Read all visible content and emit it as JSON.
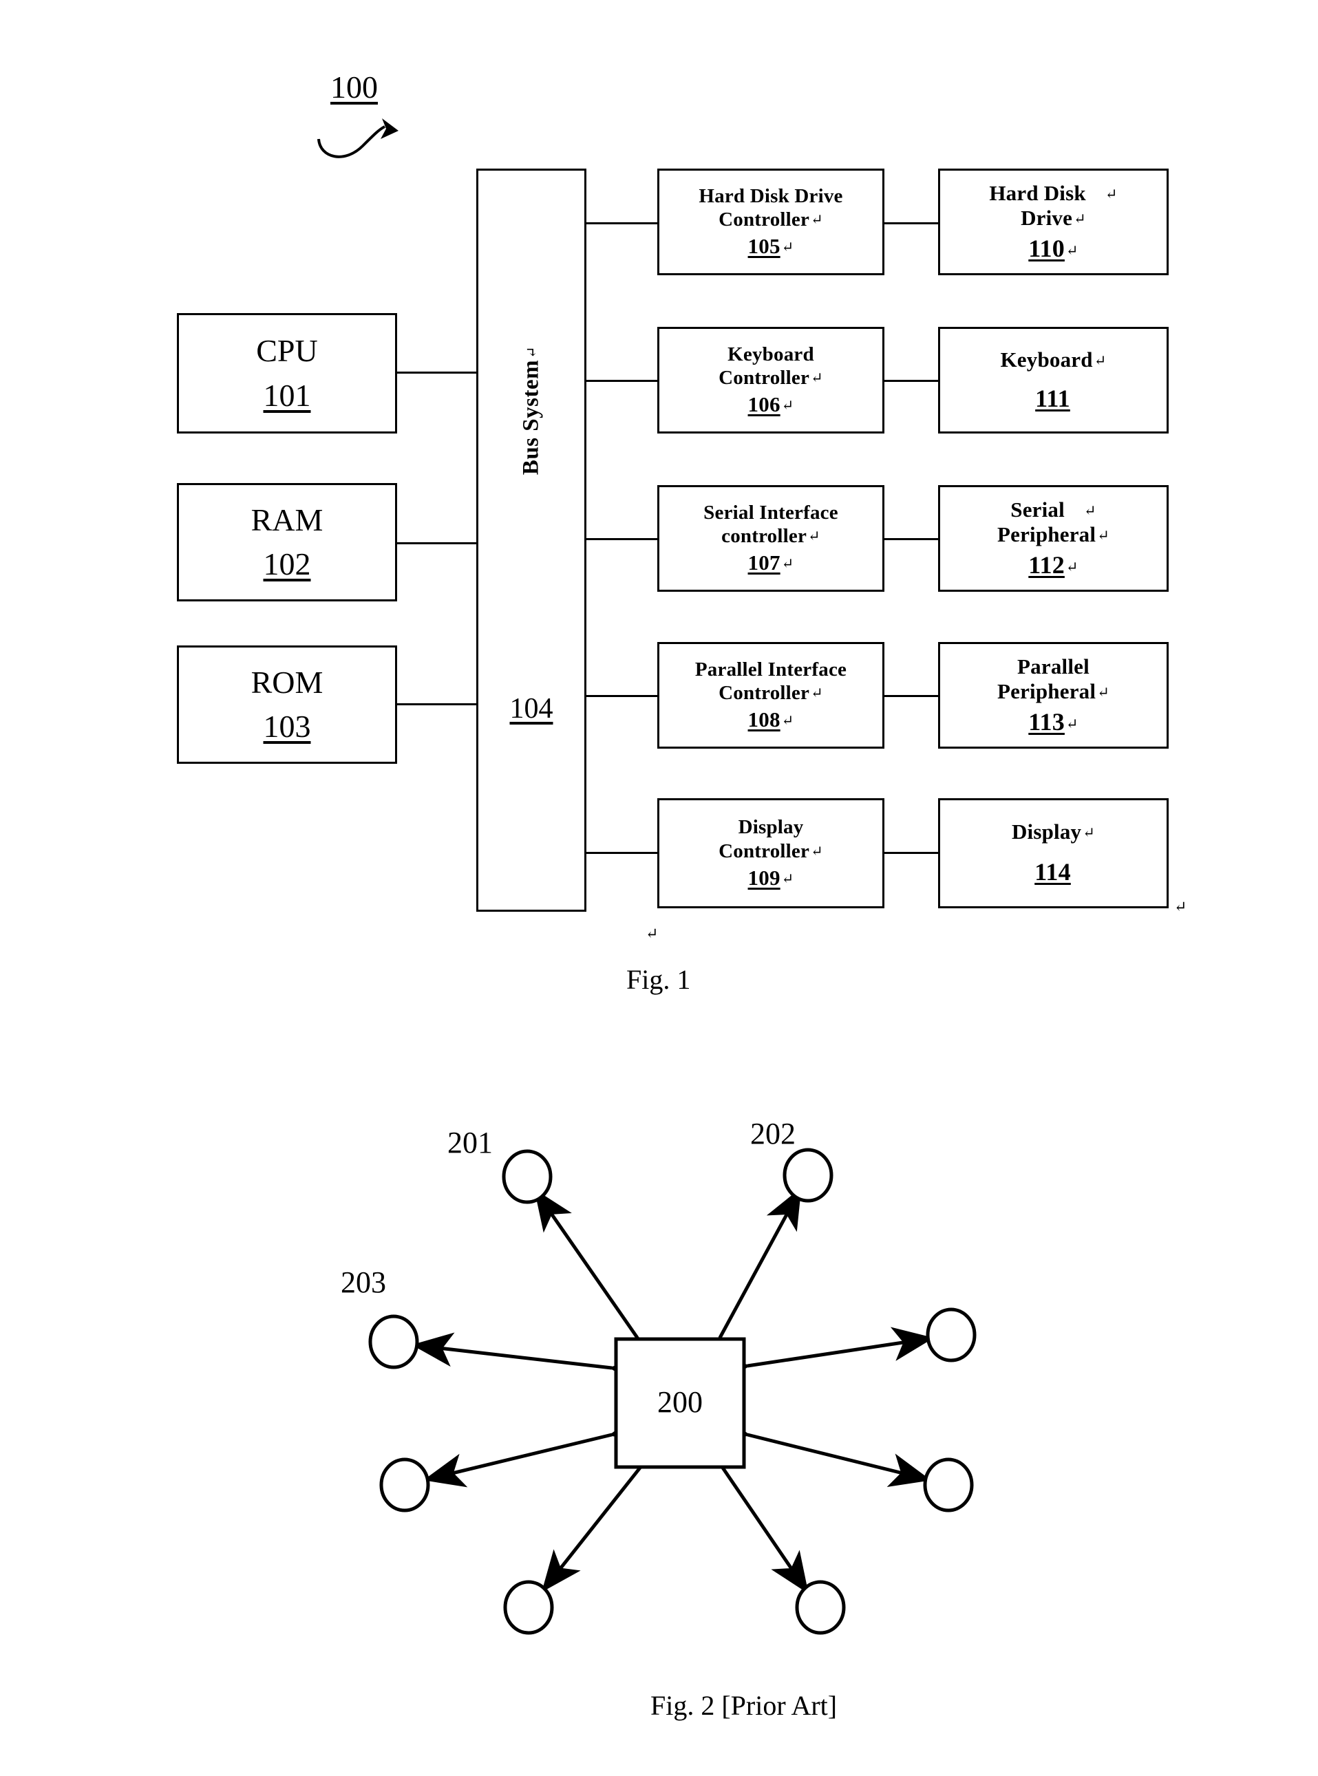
{
  "figure1": {
    "ref_label": "100",
    "caption": "Fig. 1",
    "bus": {
      "label": "Bus System",
      "label_pilcrow": "↵",
      "number": "104"
    },
    "left_column": [
      {
        "name": "CPU",
        "number": "101"
      },
      {
        "name": "RAM",
        "number": "102"
      },
      {
        "name": "ROM",
        "number": "103"
      }
    ],
    "controllers": [
      {
        "line1": "Hard Disk  Drive",
        "line2": "Controller",
        "line2_pilcrow": "↵",
        "number": "105",
        "number_pilcrow": "↵"
      },
      {
        "line1": "Keyboard",
        "line2": "Controller",
        "line2_pilcrow": "↵",
        "number": "106",
        "number_pilcrow": "↵"
      },
      {
        "line1": "Serial Interface",
        "line2": "controller",
        "line2_pilcrow": "↵",
        "number": "107",
        "number_pilcrow": "↵"
      },
      {
        "line1": "Parallel Interface",
        "line2": "Controller",
        "line2_pilcrow": "↵",
        "number": "108",
        "number_pilcrow": "↵"
      },
      {
        "line1": "Display",
        "line2": "Controller",
        "line2_pilcrow": "↵",
        "number": "109",
        "number_pilcrow": "↵"
      }
    ],
    "devices": [
      {
        "line1": "Hard Disk",
        "line1_pilcrow": "↵",
        "line1_gap": true,
        "line2": "Drive",
        "line2_pilcrow": "↵",
        "number": "110",
        "number_pilcrow": "↵"
      },
      {
        "line1": "Keyboard",
        "line1_pilcrow": "↵",
        "line1_gap": false,
        "line2": "",
        "line2_pilcrow": "",
        "number": "111",
        "number_pilcrow": ""
      },
      {
        "line1": "Serial",
        "line1_pilcrow": "↵",
        "line1_gap": true,
        "line2": "Peripheral",
        "line2_pilcrow": "↵",
        "number": "112",
        "number_pilcrow": "↵"
      },
      {
        "line1": "Parallel",
        "line1_pilcrow": "",
        "line1_gap": false,
        "line2": "Peripheral",
        "line2_pilcrow": "↵",
        "number": "113",
        "number_pilcrow": "↵"
      },
      {
        "line1": "Display",
        "line1_pilcrow": "↵",
        "line1_gap": false,
        "line2": "",
        "line2_pilcrow": "",
        "number": "114",
        "number_pilcrow": ""
      }
    ],
    "stray_marks": [
      "↵",
      "↵"
    ]
  },
  "figure2": {
    "caption": "Fig. 2 [Prior Art]",
    "center_label": "200",
    "node_labels": [
      {
        "text": "201"
      },
      {
        "text": "202"
      },
      {
        "text": "203"
      }
    ],
    "node_count": 8
  },
  "colors": {
    "ink": "#000000",
    "paper": "#ffffff"
  }
}
